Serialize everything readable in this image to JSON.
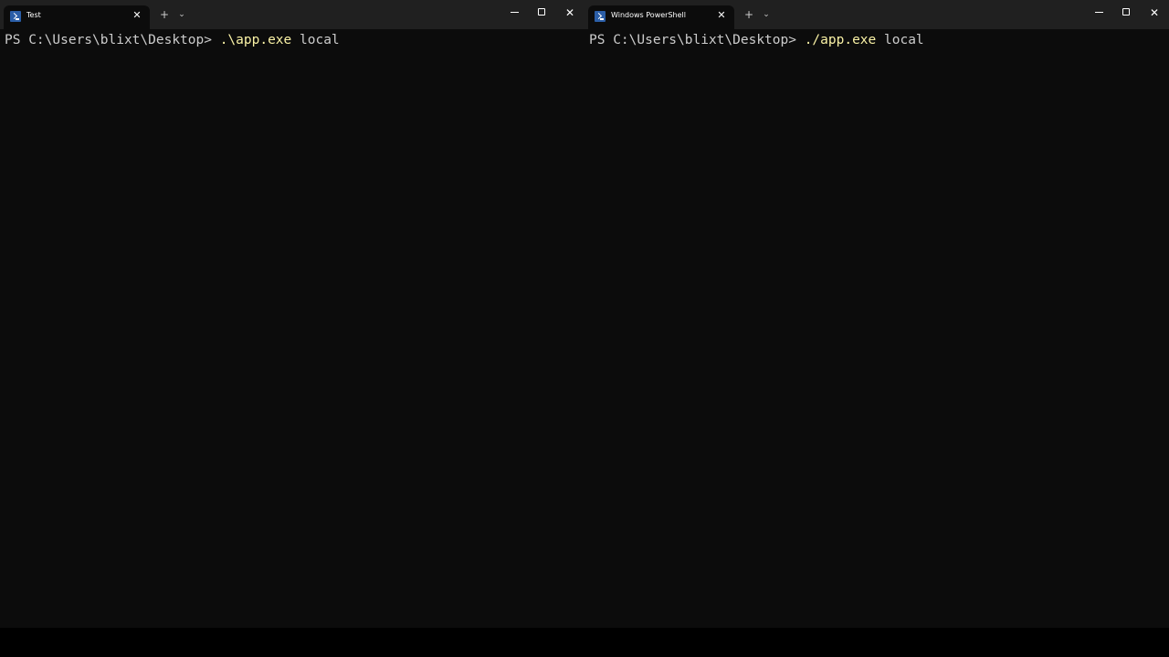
{
  "windows": [
    {
      "tab_title": "Test",
      "prompt": "PS C:\\Users\\blixt\\Desktop> ",
      "command": ".\\app.exe",
      "args": " local"
    },
    {
      "tab_title": "Windows PowerShell",
      "prompt": "PS C:\\Users\\blixt\\Desktop> ",
      "command": "./app.exe",
      "args": " local"
    }
  ],
  "icons": {
    "tab_icon": "powershell-icon",
    "close": "close-icon",
    "new_tab": "plus-icon",
    "dropdown": "chevron-down-icon",
    "minimize": "minimize-icon",
    "maximize": "maximize-icon"
  },
  "glyphs": {
    "close": "✕",
    "plus": "+",
    "chevron": "⌄"
  },
  "colors": {
    "background": "#0c0c0c",
    "titlebar": "#202020",
    "text": "#cccccc",
    "command": "#f9f1a5"
  }
}
